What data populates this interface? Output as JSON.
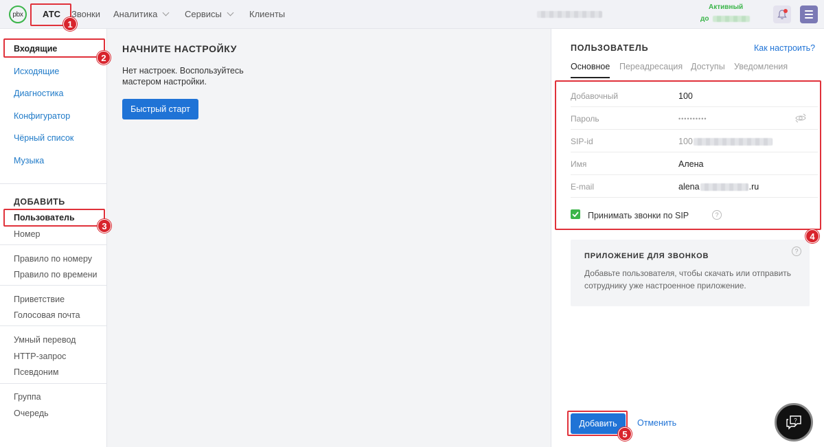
{
  "topbar": {
    "logo_text": "pbx",
    "nav": [
      {
        "label": "АТС",
        "active": true
      },
      {
        "label": "Звонки"
      },
      {
        "label": "Аналитика",
        "dropdown": true
      },
      {
        "label": "Сервисы",
        "dropdown": true
      },
      {
        "label": "Клиенты"
      }
    ],
    "status_label": "Активный",
    "status_until_prefix": "до",
    "icons": {
      "bell": "bell-icon",
      "menu": "hamburger-menu-icon"
    }
  },
  "sidebar": {
    "items": [
      {
        "label": "Входящие",
        "active": true
      },
      {
        "label": "Исходящие"
      },
      {
        "label": "Диагностика"
      },
      {
        "label": "Конфигуратор"
      },
      {
        "label": "Чёрный список"
      },
      {
        "label": "Музыка"
      }
    ],
    "add_heading": "ДОБАВИТЬ",
    "add_groups": [
      [
        "Пользователь",
        "Номер"
      ],
      [
        "Правило по номеру",
        "Правило по времени"
      ],
      [
        "Приветствие",
        "Голосовая почта"
      ],
      [
        "Умный перевод",
        "HTTP-запрос",
        "Псевдоним"
      ],
      [
        "Группа",
        "Очередь"
      ]
    ]
  },
  "main": {
    "title": "НАЧНИТЕ НАСТРОЙКУ",
    "text": "Нет настроек. Воспользуйтесь мастером настройки.",
    "quick_start_label": "Быстрый старт"
  },
  "panel": {
    "title": "ПОЛЬЗОВАТЕЛЬ",
    "howto_link": "Как настроить?",
    "tabs": [
      "Основное",
      "Переадресация",
      "Доступы",
      "Уведомления"
    ],
    "fields": [
      {
        "label": "Добавочный",
        "value": "100"
      },
      {
        "label": "Пароль",
        "value": "••••••••••"
      },
      {
        "label": "SIP-id",
        "value": "100"
      },
      {
        "label": "Имя",
        "value": "Алена"
      },
      {
        "label": "E-mail",
        "value_prefix": "alena",
        "value_suffix": ".ru"
      }
    ],
    "sip_checkbox_label": "Принимать звонки по SIP",
    "sip_checked": true,
    "app_card": {
      "title": "ПРИЛОЖЕНИЕ ДЛЯ ЗВОНКОВ",
      "text": "Добавьте пользователя, чтобы скачать или отправить сотруднику уже настроенное приложение."
    },
    "add_label": "Добавить",
    "cancel_label": "Отменить"
  },
  "annotations": [
    "1",
    "2",
    "3",
    "4",
    "5"
  ],
  "colors": {
    "accent": "#1f73d6",
    "link": "#1f7ac8",
    "green": "#3bb54a",
    "annotation": "#e0313a"
  }
}
